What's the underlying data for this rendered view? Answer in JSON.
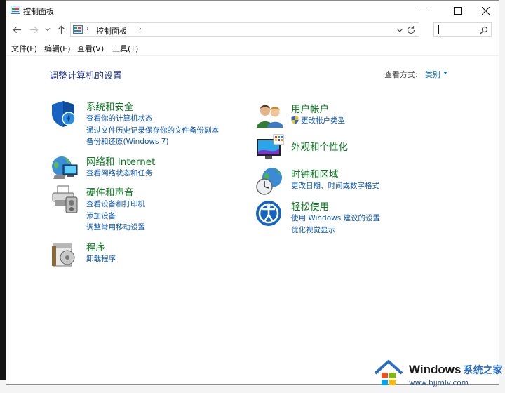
{
  "window": {
    "title": "控制面板"
  },
  "address_bar": {
    "crumb": "控制面板"
  },
  "menu": [
    "文件(F)",
    "编辑(E)",
    "查看(V)",
    "工具(T)"
  ],
  "content": {
    "heading": "调整计算机的设置",
    "view_by_label": "查看方式:",
    "view_by_value": "类别"
  },
  "categories": {
    "system_security": {
      "title": "系统和安全",
      "links": [
        "查看你的计算机状态",
        "通过文件历史记录保存你的文件备份副本",
        "备份和还原(Windows 7)"
      ]
    },
    "network": {
      "title": "网络和 Internet",
      "links": [
        "查看网络状态和任务"
      ]
    },
    "hardware": {
      "title": "硬件和声音",
      "links": [
        "查看设备和打印机",
        "添加设备",
        "调整常用移动设置"
      ]
    },
    "programs": {
      "title": "程序",
      "links": [
        "卸载程序"
      ]
    },
    "user_accounts": {
      "title": "用户帐户",
      "links": [
        "更改帐户类型"
      ]
    },
    "appearance": {
      "title": "外观和个性化",
      "links": []
    },
    "clock_region": {
      "title": "时钟和区域",
      "links": [
        "更改日期、时间或数字格式"
      ]
    },
    "ease_access": {
      "title": "轻松使用",
      "links": [
        "使用 Windows 建议的设置",
        "优化视觉显示"
      ]
    }
  },
  "watermark": {
    "brand": "Windows",
    "brand_cn": "系统之家",
    "url": "www.bjjmlv.com"
  }
}
